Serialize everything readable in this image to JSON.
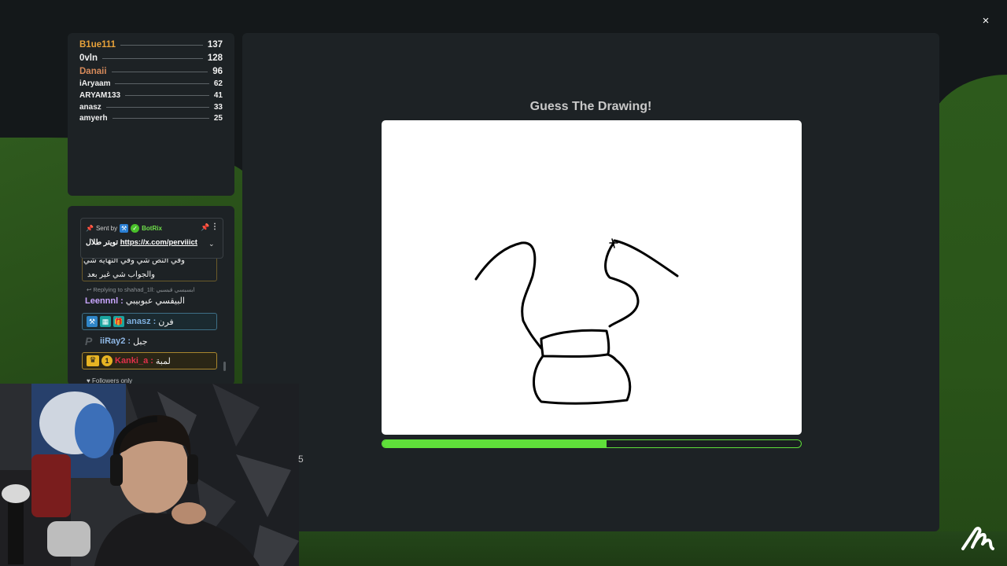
{
  "window": {
    "close_label": "×"
  },
  "leaderboard": {
    "rows": [
      {
        "name": "B1ue111",
        "score": "137"
      },
      {
        "name": "0vln",
        "score": "128"
      },
      {
        "name": "Danaii",
        "score": "96"
      },
      {
        "name": "iAryaam",
        "score": "62"
      },
      {
        "name": "ARYAM133",
        "score": "41"
      },
      {
        "name": "anasz",
        "score": "33"
      },
      {
        "name": "amyerh",
        "score": "25"
      }
    ]
  },
  "chat": {
    "pinned": {
      "sent_by": "Sent by",
      "bot_name": "BotRix",
      "message_prefix": "تويتر طلال",
      "message_link": "https://x.com/perviiict"
    },
    "message_box": {
      "line1": "وفي النص شي وفي النهايه شي",
      "line2": "والجواب شي غير بعد"
    },
    "reply": {
      "text": "Replying to shahad_1ll: ابسبسي قبسبي"
    },
    "lines": [
      {
        "user": "Leennnl",
        "text": "البيقسي عبوبيبي"
      },
      {
        "user": "anasz",
        "text": "فرن"
      },
      {
        "user": "iiRay2",
        "text": "جبل"
      },
      {
        "user": "Kanki_a",
        "text": "لمبة"
      }
    ],
    "followers_only": "Followers only"
  },
  "game": {
    "title": "Guess The Drawing!",
    "timer_progress": 0.536
  },
  "overlay": {
    "stray_number": "5"
  },
  "colors": {
    "accent_green": "#5fe03a",
    "panel": "#1d2225",
    "gold": "#e8a23a"
  }
}
